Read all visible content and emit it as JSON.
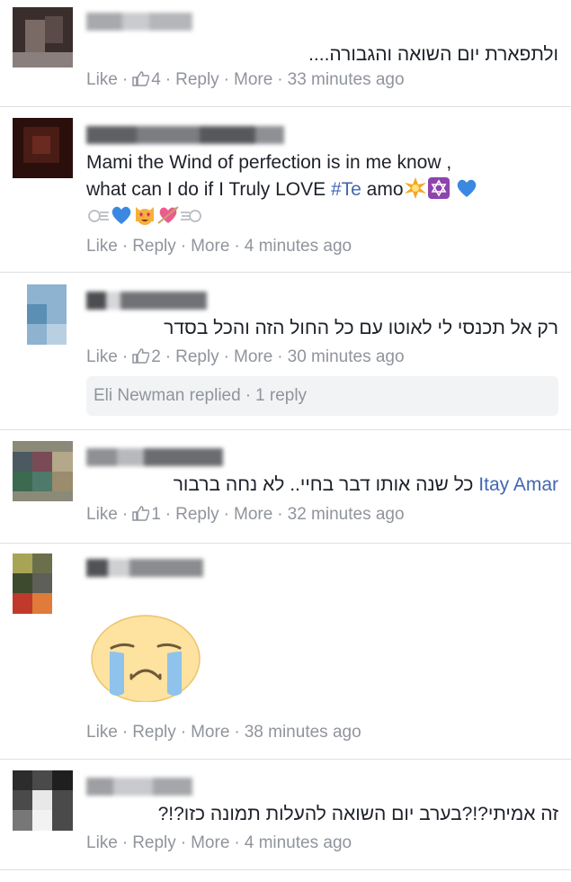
{
  "comments": [
    {
      "text": "ולתפארת יום השואה והגבורה....",
      "meta": {
        "like": "Like",
        "likes_count": "4",
        "reply": "Reply",
        "more": "More",
        "time": "33 minutes ago"
      }
    },
    {
      "line1": "Mami the Wind of perfection is in me know ,",
      "line2_prefix": "what can I do if I Truly LOVE ",
      "hashtag": "#Te",
      "line2_suffix": " amo",
      "meta": {
        "like": "Like",
        "reply": "Reply",
        "more": "More",
        "time": "4 minutes ago"
      }
    },
    {
      "text": "רק אל תכנסי לי לאוטו עם כל החול הזה והכל בסדר",
      "meta": {
        "like": "Like",
        "likes_count": "2",
        "reply": "Reply",
        "more": "More",
        "time": "30 minutes ago"
      },
      "replies": {
        "author": "Eli Newman",
        "action": "replied",
        "count": "1 reply"
      }
    },
    {
      "mention": "Itay Amar",
      "text": "כל שנה אותו דבר בחיי.. לא נחה ברבור",
      "meta": {
        "like": "Like",
        "likes_count": "1",
        "reply": "Reply",
        "more": "More",
        "time": "32 minutes ago"
      }
    },
    {
      "sticker": "crying-face",
      "meta": {
        "like": "Like",
        "reply": "Reply",
        "more": "More",
        "time": "38 minutes ago"
      }
    },
    {
      "text": "זה אמיתי?!?בערב יום השואה להעלות תמונה כזו?!?",
      "meta": {
        "like": "Like",
        "reply": "Reply",
        "more": "More",
        "time": "4 minutes ago"
      }
    }
  ],
  "colors": {
    "link": "#4267b2",
    "meta": "#90949c",
    "text": "#1d2129",
    "separator": "#dddfe2",
    "reply_bg": "#f2f3f5"
  },
  "meta_separator": "·"
}
